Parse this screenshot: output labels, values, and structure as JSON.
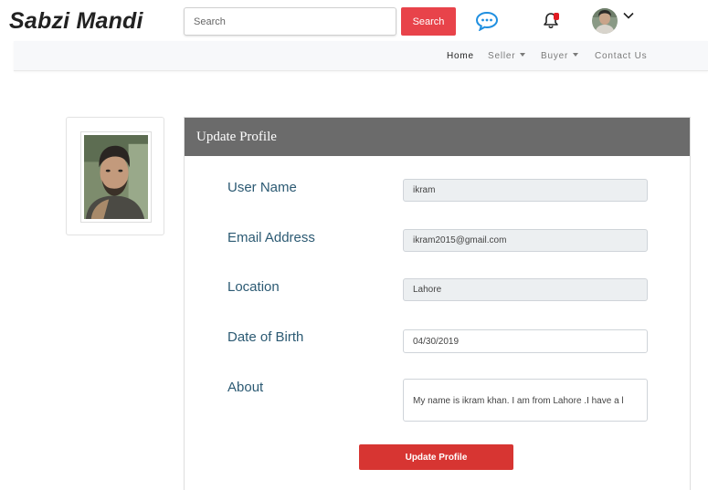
{
  "header": {
    "brand": "Sabzi Mandi",
    "search": {
      "placeholder": "Search",
      "value": ""
    },
    "search_button_label": "Search",
    "icons": {
      "chat": "chat-bubble-icon",
      "notifications": "bell-icon",
      "account_menu": "chevron-down-icon"
    },
    "colors": {
      "search_button": "#e8434a",
      "chat_icon": "#1f8fe0",
      "notification_badge": "#e01b22"
    }
  },
  "nav": {
    "items": [
      {
        "label": "Home",
        "dropdown": false,
        "active": true
      },
      {
        "label": "Seller",
        "dropdown": true,
        "active": false
      },
      {
        "label": "Buyer",
        "dropdown": true,
        "active": false
      },
      {
        "label": "Contact Us",
        "dropdown": false,
        "active": false
      }
    ]
  },
  "profile": {
    "title": "Update Profile",
    "fields": [
      {
        "label": "User Name",
        "value": "ikram",
        "editable": false
      },
      {
        "label": "Email Address",
        "value": "ikram2015@gmail.com",
        "editable": false
      },
      {
        "label": "Location",
        "value": "Lahore",
        "editable": false
      },
      {
        "label": "Date of Birth",
        "value": "04/30/2019",
        "editable": true
      },
      {
        "label": "About",
        "value": "My name is ikram khan. I am from Lahore .I have a l",
        "editable": true
      }
    ],
    "submit_label": "Update Profile",
    "colors": {
      "header_bg": "#6b6b6b",
      "label_text": "#2c5a73",
      "submit_button": "#d73532"
    }
  }
}
